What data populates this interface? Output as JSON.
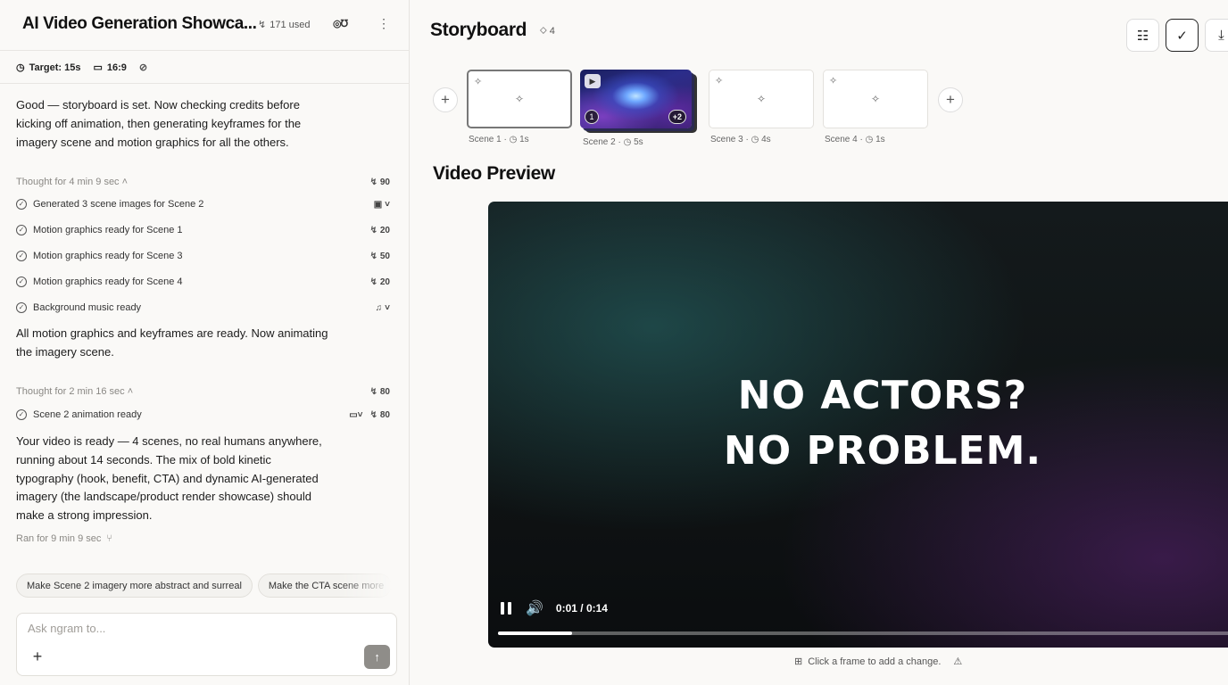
{
  "header": {
    "title": "AI Video Generation Showca...",
    "credits_used": "171 used",
    "avatar_label": "👥"
  },
  "meta": {
    "target": "Target: 15s",
    "aspect": "16:9"
  },
  "chat": {
    "msg1": [
      "Good — storyboard is set. Now checking credits before",
      "kicking off animation, then generating keyframes for the",
      "imagery scene and motion graphics for all the others."
    ],
    "thought1": {
      "label": "Thought for 4 min 9 sec",
      "cost": "90"
    },
    "steps1": [
      {
        "label": "Generated 3 scene images for Scene 2",
        "right": "image-icon"
      },
      {
        "label": "Motion graphics ready for Scene 1",
        "cost": "20"
      },
      {
        "label": "Motion graphics ready for Scene 3",
        "cost": "50"
      },
      {
        "label": "Motion graphics ready for Scene 4",
        "cost": "20"
      },
      {
        "label": "Background music ready",
        "right": "music-icon"
      }
    ],
    "msg2": [
      "All motion graphics and keyframes are ready. Now animating",
      "the imagery scene."
    ],
    "thought2": {
      "label": "Thought for 2 min 16 sec",
      "cost": "80"
    },
    "steps2": [
      {
        "label": "Scene 2 animation ready",
        "cost": "80",
        "right": "video-icon"
      }
    ],
    "msg3": [
      "Your video is ready — 4 scenes, no real humans anywhere,",
      "running about 14 seconds. The mix of bold kinetic",
      "typography (hook, benefit, CTA) and dynamic AI-generated",
      "imagery (the landscape/product render showcase) should",
      "make a strong impression."
    ],
    "ran_for": "Ran for 9 min 9 sec"
  },
  "suggestions": [
    "Make Scene 2 imagery more abstract and surreal",
    "Make the CTA scene more"
  ],
  "composer": {
    "placeholder": "Ask ngram to..."
  },
  "storyboard": {
    "title": "Storyboard",
    "count": "4",
    "scenes": [
      {
        "name": "Scene 1",
        "duration": "1s"
      },
      {
        "name": "Scene 2",
        "duration": "5s",
        "image_index": "1",
        "more": "+2"
      },
      {
        "name": "Scene 3",
        "duration": "4s"
      },
      {
        "name": "Scene 4",
        "duration": "1s"
      }
    ]
  },
  "preview": {
    "title": "Video Preview",
    "line1": "NO ACTORS?",
    "line2": "NO PROBLEM.",
    "time": "0:01 / 0:14",
    "progress_fraction": 0.1,
    "hint": "Click a frame to add a change."
  }
}
